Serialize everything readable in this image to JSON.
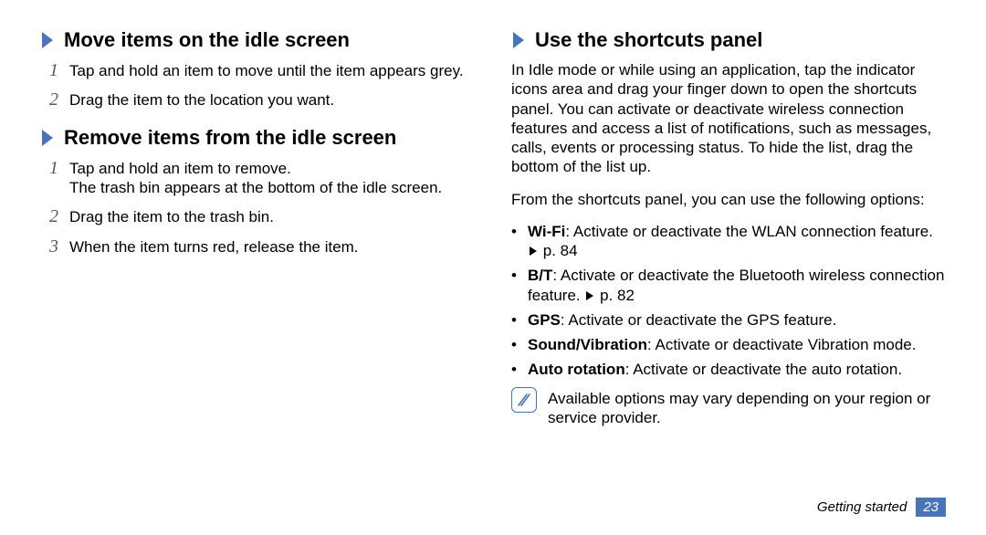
{
  "left": {
    "section1": {
      "title": "Move items on the idle screen",
      "steps": [
        "Tap and hold an item to move until the item appears grey.",
        "Drag the item to the location you want."
      ]
    },
    "section2": {
      "title": "Remove items from the idle screen",
      "steps": [
        "Tap and hold an item to remove.\nThe trash bin appears at the bottom of the idle screen.",
        "Drag the item to the trash bin.",
        "When the item turns red, release the item."
      ]
    }
  },
  "right": {
    "section1": {
      "title": "Use the shortcuts panel",
      "intro": "In Idle mode or while using an application, tap the indicator icons area and drag your finger down to open the shortcuts panel. You can activate or deactivate wireless connection features and access a list of notifications, such as messages, calls, events or processing status. To hide the list, drag the bottom of the list up.",
      "lead": "From the shortcuts panel, you can use the following options:",
      "bullets": [
        {
          "bold": "Wi-Fi",
          "rest": ": Activate or deactivate the WLAN connection feature. ",
          "pref": "p. 84"
        },
        {
          "bold": "B/T",
          "rest": ": Activate or deactivate the Bluetooth wireless connection feature. ",
          "pref": "p. 82"
        },
        {
          "bold": "GPS",
          "rest": ": Activate or deactivate the GPS feature.",
          "pref": ""
        },
        {
          "bold": "Sound/Vibration",
          "rest": ": Activate or deactivate Vibration mode.",
          "pref": ""
        },
        {
          "bold": "Auto rotation",
          "rest": ": Activate or deactivate the auto rotation.",
          "pref": ""
        }
      ],
      "note": "Available options may vary depending on your region or service provider."
    }
  },
  "footer": {
    "chapter": "Getting started",
    "page": "23"
  }
}
